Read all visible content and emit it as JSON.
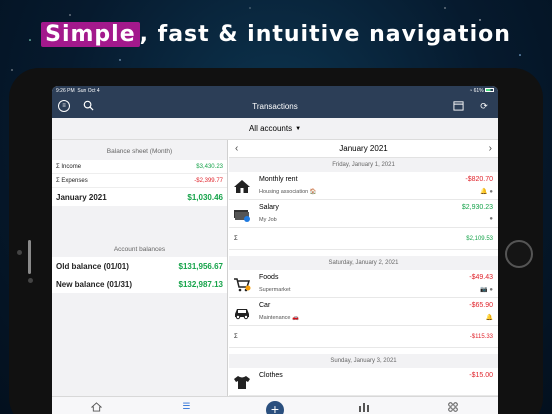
{
  "headline": {
    "highlight": "Simple",
    "rest": ", fast & intuitive navigation"
  },
  "status": {
    "time": "9:26 PM",
    "date": "Sun Oct 4",
    "battery": "61%"
  },
  "navbar": {
    "title": "Transactions"
  },
  "account_selector": {
    "label": "All accounts",
    "caret": "▼"
  },
  "balance_sheet": {
    "title": "Balance sheet (Month)",
    "income_label": "Σ  Income",
    "income_value": "$3,430.23",
    "expenses_label": "Σ  Expenses",
    "expenses_value": "-$2,399.77",
    "period_label": "January 2021",
    "period_value": "$1,030.46"
  },
  "account_balances": {
    "title": "Account balances",
    "old_label": "Old balance (01/01)",
    "old_value": "$131,956.67",
    "new_label": "New balance (01/31)",
    "new_value": "$132,987.13"
  },
  "month_nav": {
    "title": "January 2021",
    "prev": "‹",
    "next": "›"
  },
  "days": [
    {
      "header": "Friday, January 1, 2021",
      "transactions": [
        {
          "name": "Monthly rent",
          "category": "Housing association 🏠",
          "amount": "-$820.70",
          "flags": "🔔 ●",
          "icon": "house-icon",
          "sign": "neg"
        },
        {
          "name": "Salary",
          "category": "My Job",
          "amount": "$2,930.23",
          "flags": "●",
          "icon": "money-icon",
          "sign": "pos"
        }
      ],
      "sum_label": "Σ",
      "sum": "$2,109.53",
      "sum_sign": "pos"
    },
    {
      "header": "Saturday, January 2, 2021",
      "transactions": [
        {
          "name": "Foods",
          "category": "Supermarket",
          "amount": "-$49.43",
          "flags": "📷 ●",
          "icon": "cart-icon",
          "sign": "neg"
        },
        {
          "name": "Car",
          "category": "Maintenance 🚗",
          "amount": "-$65.90",
          "flags": "🔔",
          "icon": "car-icon",
          "sign": "neg"
        }
      ],
      "sum_label": "Σ",
      "sum": "-$115.33",
      "sum_sign": "neg"
    },
    {
      "header": "Sunday, January 3, 2021",
      "transactions": [
        {
          "name": "Clothes",
          "category": "",
          "amount": "-$15.00",
          "flags": "",
          "icon": "shirt-icon",
          "sign": "neg"
        }
      ]
    }
  ],
  "tabbar": {
    "add": "+"
  },
  "colors": {
    "navbar": "#2c3e57",
    "positive": "#16a34a",
    "negative": "#e0242c",
    "highlight": "#a3198c"
  }
}
